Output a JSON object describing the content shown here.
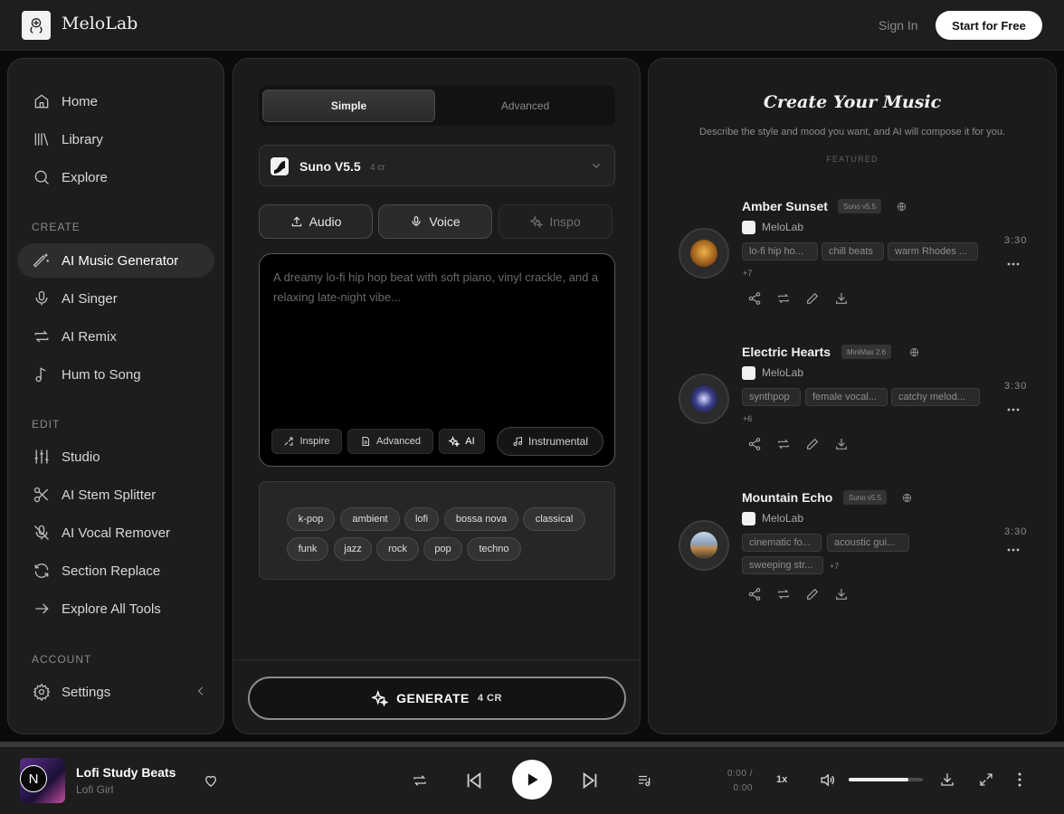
{
  "header": {
    "brand": "MeloLab",
    "sign_in": "Sign In",
    "start_free": "Start for Free"
  },
  "sidebar": {
    "main": [
      {
        "label": "Home",
        "icon": "home-icon"
      },
      {
        "label": "Library",
        "icon": "library-icon"
      },
      {
        "label": "Explore",
        "icon": "search-icon"
      }
    ],
    "create_heading": "CREATE",
    "create": [
      {
        "label": "AI Music Generator",
        "icon": "magic-wand-icon",
        "active": true
      },
      {
        "label": "AI Singer",
        "icon": "microphone-icon"
      },
      {
        "label": "AI Remix",
        "icon": "repeat-icon"
      },
      {
        "label": "Hum to Song",
        "icon": "music-note-icon"
      }
    ],
    "edit_heading": "EDIT",
    "edit": [
      {
        "label": "Studio",
        "icon": "sliders-icon"
      },
      {
        "label": "AI Stem Splitter",
        "icon": "scissors-icon"
      },
      {
        "label": "AI Vocal Remover",
        "icon": "mic-off-icon"
      },
      {
        "label": "Section Replace",
        "icon": "refresh-icon"
      },
      {
        "label": "Explore All Tools",
        "icon": "arrow-right-icon"
      }
    ],
    "account_heading": "ACCOUNT",
    "account": [
      {
        "label": "Settings",
        "icon": "gear-icon"
      }
    ]
  },
  "generator": {
    "mode_tabs": [
      "Simple",
      "Advanced"
    ],
    "active_mode": "Simple",
    "model": {
      "name": "Suno V5.5",
      "credits": "4 cr"
    },
    "sources": [
      "Audio",
      "Voice",
      "Inspo"
    ],
    "prompt_placeholder": "A dreamy lo-fi hip hop beat with soft piano, vinyl crackle, and a relaxing late-night vibe...",
    "prompt_chips": [
      "Inspire",
      "Advanced",
      "AI",
      "Instrumental"
    ],
    "genre_tags": [
      "k-pop",
      "ambient",
      "lofi",
      "bossa nova",
      "classical",
      "funk",
      "jazz",
      "rock",
      "pop",
      "techno"
    ],
    "generate_label": "GENERATE",
    "generate_credits": "4 CR"
  },
  "showcase": {
    "title": "Create Your Music",
    "subtitle": "Describe the style and mood you want, and AI will compose it for you.",
    "featured_label": "FEATURED",
    "tracks": [
      {
        "name": "Amber Sunset",
        "model": "Suno v5.5",
        "author": "MeloLab",
        "tags": [
          "lo-fi hip ho...",
          "chill beats",
          "warm Rhodes ..."
        ],
        "more": "+7",
        "duration": "3:30"
      },
      {
        "name": "Electric Hearts",
        "model": "MiniMax 2.6",
        "author": "MeloLab",
        "tags": [
          "synthpop",
          "female vocal...",
          "catchy melod..."
        ],
        "more": "+6",
        "duration": "3:30"
      },
      {
        "name": "Mountain Echo",
        "model": "Suno v5.5",
        "author": "MeloLab",
        "tags": [
          "cinematic fo...",
          "acoustic gui...",
          "sweeping str..."
        ],
        "more": "+7",
        "duration": "3:30"
      }
    ]
  },
  "player": {
    "title": "Lofi Study Beats",
    "artist": "Lofi Girl",
    "cover_letter": "N",
    "current_time": "0:00 /",
    "total_time": "0:00",
    "speed": "1x",
    "volume": 0.8
  }
}
